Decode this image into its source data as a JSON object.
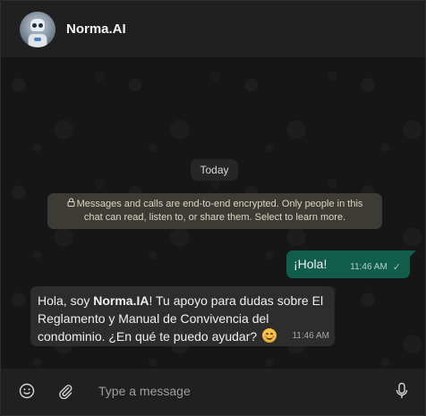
{
  "header": {
    "contact_name": "Norma.AI",
    "avatar_icon": "robot-avatar"
  },
  "chat": {
    "date_chip": "Today",
    "encryption_notice": "Messages and calls are end-to-end encrypted. Only people in this chat can read, listen to, or share them. Select to learn more.",
    "messages": [
      {
        "direction": "outgoing",
        "text": "¡Hola!",
        "time": "11:46 AM",
        "status": "sent"
      },
      {
        "direction": "incoming",
        "text_before": "Hola, soy ",
        "text_bold": "Norma.IA",
        "text_after": "! Tu apoyo para dudas sobre El Reglamento y Manual de Convivencia del condominio. ¿En qué te puedo ayudar? ",
        "emoji": "smiling-face",
        "time": "11:46 AM"
      }
    ]
  },
  "composer": {
    "placeholder": "Type a message",
    "value": "",
    "icons": [
      "emoji-icon",
      "attach-icon",
      "mic-icon"
    ]
  },
  "colors": {
    "outgoing_bubble": "#115d4b",
    "incoming_bubble": "#2d2d2d",
    "notice_bg": "#3d3b35",
    "header_bg": "#202020"
  }
}
